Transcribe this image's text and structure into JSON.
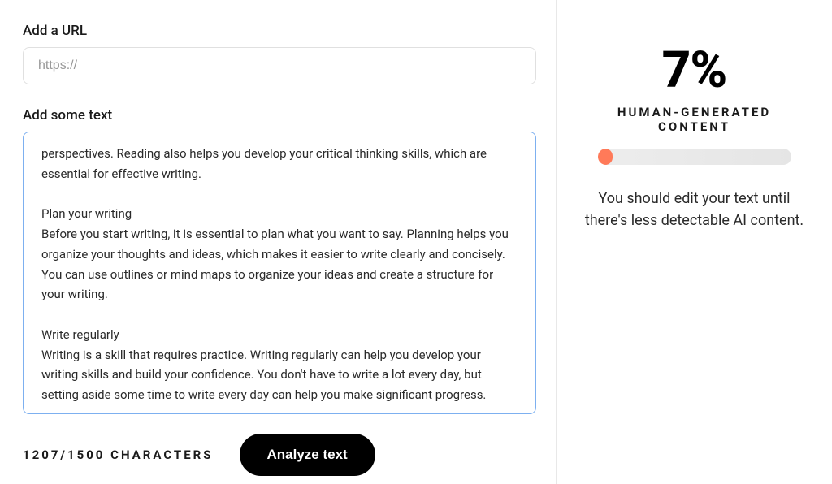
{
  "url_section": {
    "label": "Add a URL",
    "placeholder": "https://"
  },
  "text_section": {
    "label": "Add some text",
    "content": "perspectives. Reading also helps you develop your critical thinking skills, which are essential for effective writing.\n\nPlan your writing\nBefore you start writing, it is essential to plan what you want to say. Planning helps you organize your thoughts and ideas, which makes it easier to write clearly and concisely. You can use outlines or mind maps to organize your ideas and create a structure for your writing.\n\nWrite regularly\nWriting is a skill that requires practice. Writing regularly can help you develop your writing skills and build your confidence. You don't have to write a lot every day, but setting aside some time to write every day can help you make significant progress."
  },
  "counter": {
    "current": 1207,
    "max": 1500,
    "display": "1207/1500 CHARACTERS"
  },
  "analyze_button": "Analyze text",
  "result": {
    "percent": "7%",
    "label": "HUMAN-GENERATED CONTENT",
    "progress_value": 7,
    "advice": "You should edit your text until there's less detectable AI content."
  },
  "colors": {
    "accent": "#ff7a59",
    "focus_border": "#7db0f0"
  }
}
